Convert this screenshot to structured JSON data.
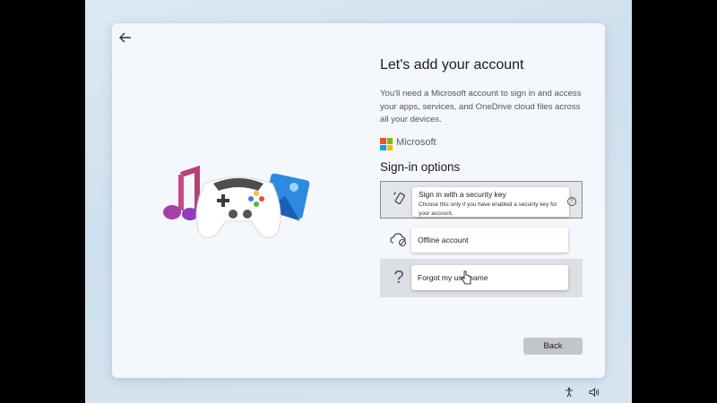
{
  "header": {
    "title": "Let's add your account"
  },
  "description": "You'll need a Microsoft account to sign in and access your apps, services, and OneDrive cloud files across all your devices.",
  "brand": {
    "name": "Microsoft",
    "logo_colors": [
      "#f25022",
      "#7fba00",
      "#00a4ef",
      "#ffb900"
    ]
  },
  "signin": {
    "heading": "Sign-in options",
    "options": [
      {
        "icon": "usb-security-key-icon",
        "label": "Sign in with a security key",
        "sublabel": "Choose this only if you have enabled a security key for your account."
      },
      {
        "icon": "cloud-offline-icon",
        "label": "Offline account"
      },
      {
        "icon": "question-mark-icon",
        "label": "Forgot my username"
      }
    ]
  },
  "footer": {
    "back_label": "Back"
  },
  "tray": {
    "icons": [
      "accessibility-icon",
      "volume-icon"
    ]
  }
}
